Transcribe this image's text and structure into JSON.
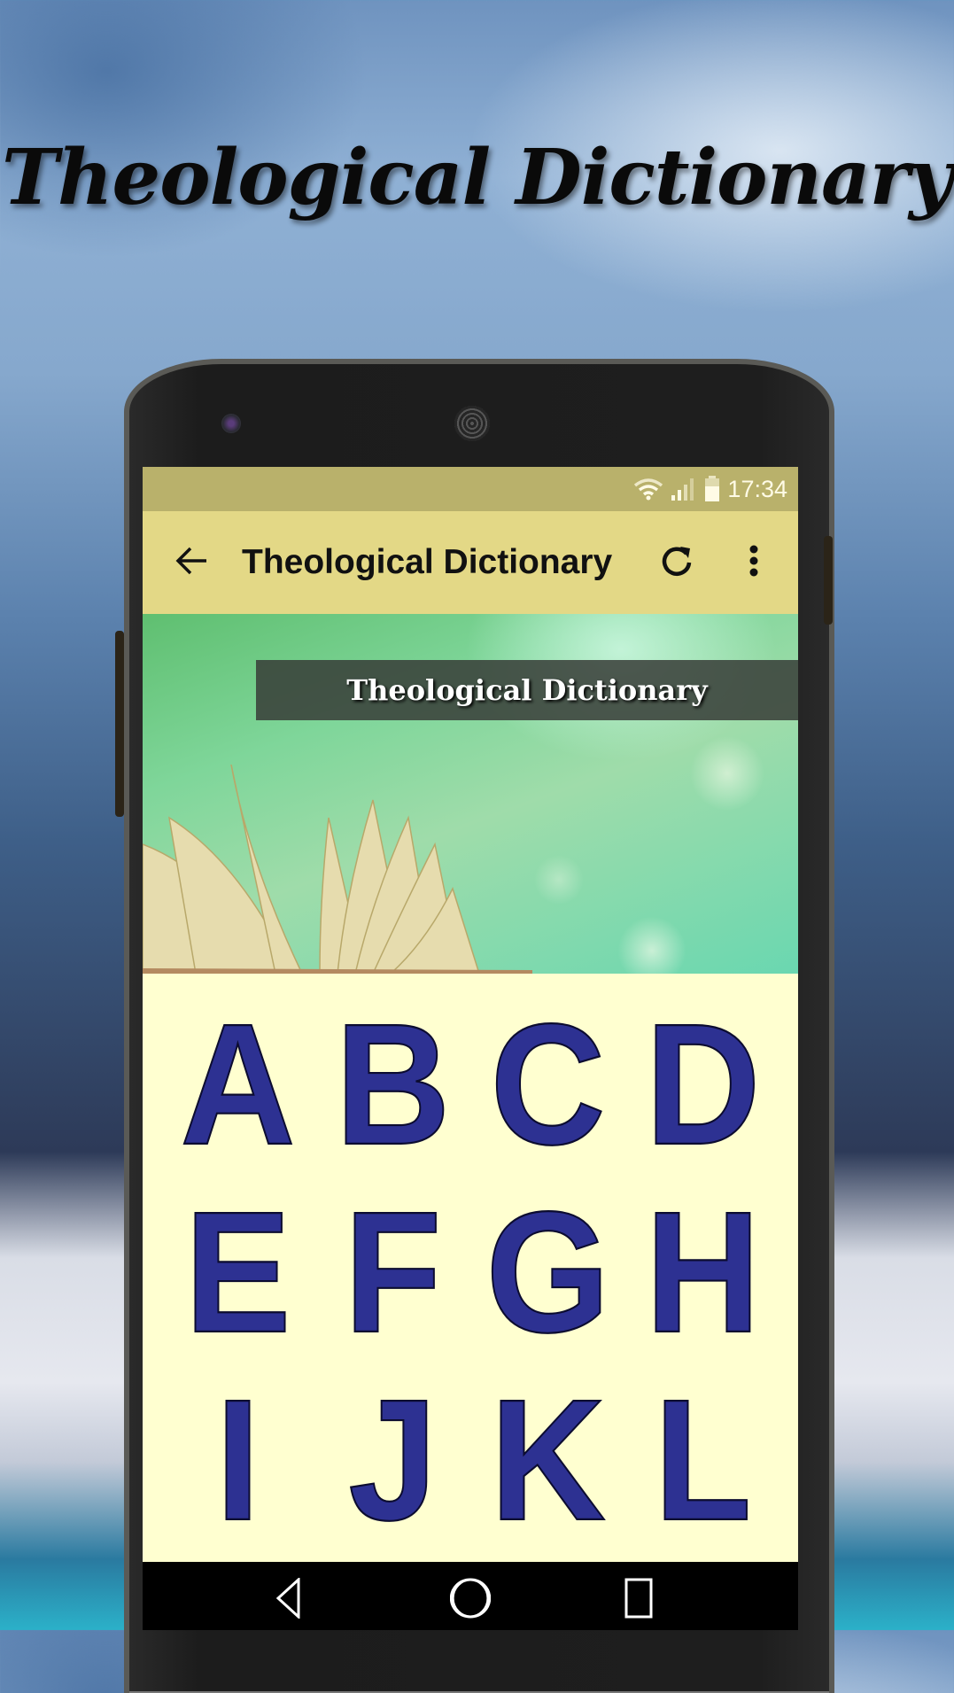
{
  "promo": {
    "title": "Theological Dictionary"
  },
  "status_bar": {
    "icons": [
      "wifi-icon",
      "signal-icon",
      "battery-icon"
    ],
    "time": "17:34"
  },
  "app_bar": {
    "back_icon": "arrow-left-icon",
    "title": "Theological Dictionary",
    "refresh_icon": "refresh-icon",
    "menu_icon": "more-vertical-icon"
  },
  "banner": {
    "label": "Theological Dictionary",
    "image": "open-book-icon"
  },
  "letters": [
    "A",
    "B",
    "C",
    "D",
    "E",
    "F",
    "G",
    "H",
    "I",
    "J",
    "K",
    "L"
  ],
  "nav_bar": {
    "back_icon": "triangle-back-icon",
    "home_icon": "circle-home-icon",
    "recents_icon": "square-recents-icon"
  },
  "colors": {
    "status_bar": "#b9b16b",
    "app_bar": "#e3d886",
    "content_bg": "#ffffd0",
    "letter_fill": "#2d3192",
    "nav_bar": "#000000"
  }
}
